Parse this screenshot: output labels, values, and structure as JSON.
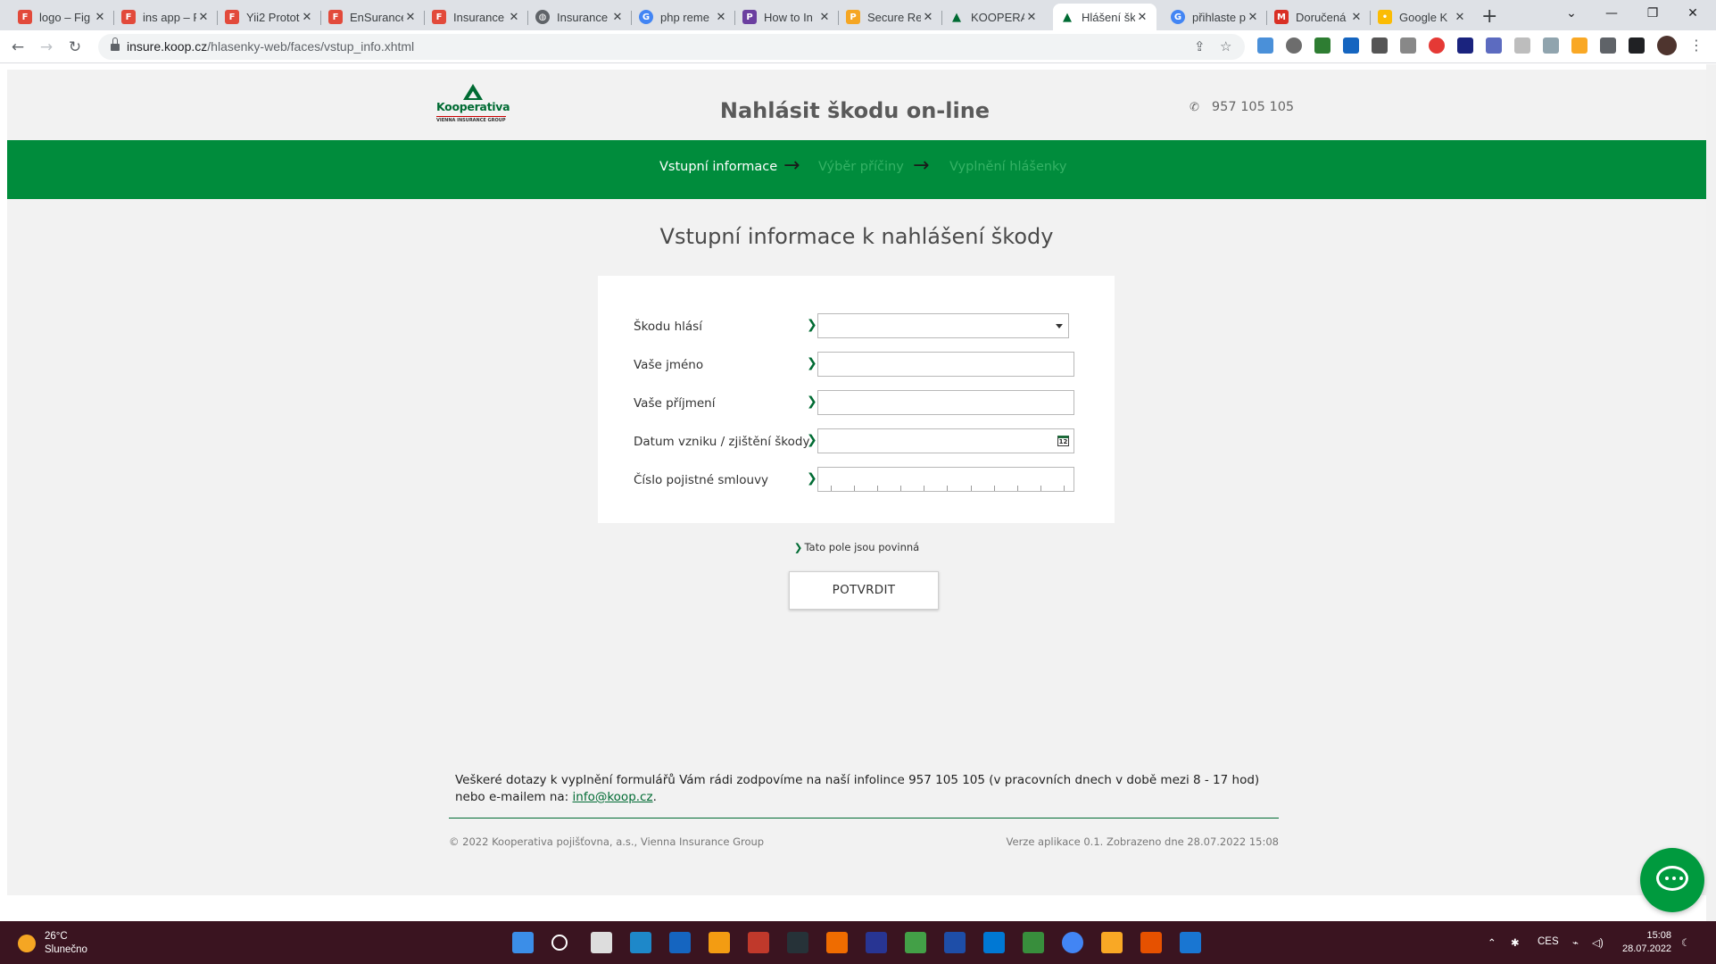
{
  "browser": {
    "tabs": [
      {
        "label": "logo – Fig",
        "icon": "figma-icon",
        "color": "#e24a3b"
      },
      {
        "label": "ins app – F",
        "icon": "figma-icon",
        "color": "#e24a3b"
      },
      {
        "label": "Yii2 Protot",
        "icon": "figma-icon",
        "color": "#e24a3b"
      },
      {
        "label": "EnSurance",
        "icon": "figma-icon",
        "color": "#e24a3b"
      },
      {
        "label": "Insurance",
        "icon": "figma-icon",
        "color": "#e24a3b"
      },
      {
        "label": "Insurance",
        "icon": "globe-icon",
        "color": "#5f6368"
      },
      {
        "label": "php reme",
        "icon": "google-icon",
        "color": "#4285f4"
      },
      {
        "label": "How to In",
        "icon": "p-icon",
        "color": "#6b3fa0"
      },
      {
        "label": "Secure Re",
        "icon": "p-icon",
        "color": "#f5a623"
      },
      {
        "label": "KOOPERA",
        "icon": "kooperativa-icon",
        "color": "#006b33"
      },
      {
        "label": "Hlášení šk",
        "icon": "kooperativa-icon",
        "color": "#006b33",
        "active": true
      },
      {
        "label": "přihlaste p",
        "icon": "google-icon",
        "color": "#4285f4"
      },
      {
        "label": "Doručená",
        "icon": "gmail-icon",
        "color": "#d93025"
      },
      {
        "label": "Google K",
        "icon": "keep-icon",
        "color": "#fbbc04"
      }
    ],
    "url_host": "insure.koop.cz",
    "url_path": "/hlasenky-web/faces/vstup_info.xhtml"
  },
  "site": {
    "logo_text": "Kooperativa",
    "logo_subtext": "VIENNA INSURANCE GROUP",
    "title": "Nahlásit škodu on-line",
    "phone": "957 105 105"
  },
  "steps": [
    {
      "label": "Vstupní informace",
      "active": true
    },
    {
      "label": "Výběr příčiny",
      "active": false
    },
    {
      "label": "Vyplnění hlášenky",
      "active": false
    }
  ],
  "form": {
    "title": "Vstupní informace k nahlášení škody",
    "fields": [
      {
        "label": "Škodu hlásí",
        "type": "select",
        "value": ""
      },
      {
        "label": "Vaše jméno",
        "type": "text",
        "value": ""
      },
      {
        "label": "Vaše příjmení",
        "type": "text",
        "value": ""
      },
      {
        "label": "Datum vzniku / zjištění škody",
        "type": "date",
        "value": "",
        "calendar_day": "12"
      },
      {
        "label": "Číslo pojistné smlouvy",
        "type": "masked",
        "value": ""
      }
    ],
    "required_note": "Tato pole jsou povinná",
    "submit_label": "POTVRDIT"
  },
  "footer": {
    "info_text": "Veškeré dotazy k vyplnění formulářů Vám rádi zodpovíme na naší infolince 957 105 105 (v pracovních dnech v době mezi 8 - 17 hod) nebo e-mailem na:",
    "email": "info@koop.cz",
    "copyright": "© 2022 Kooperativa pojišťovna, a.s., Vienna Insurance Group",
    "version": "Verze aplikace 0.1. Zobrazeno dne 28.07.2022 15:08"
  },
  "taskbar": {
    "temperature": "26°C",
    "weather": "Slunečno",
    "language": "CES",
    "time": "15:08",
    "date": "28.07.2022"
  },
  "colors": {
    "brand_green": "#008c3c",
    "inactive_step": "#35b265",
    "taskbar": "#3a1420"
  }
}
